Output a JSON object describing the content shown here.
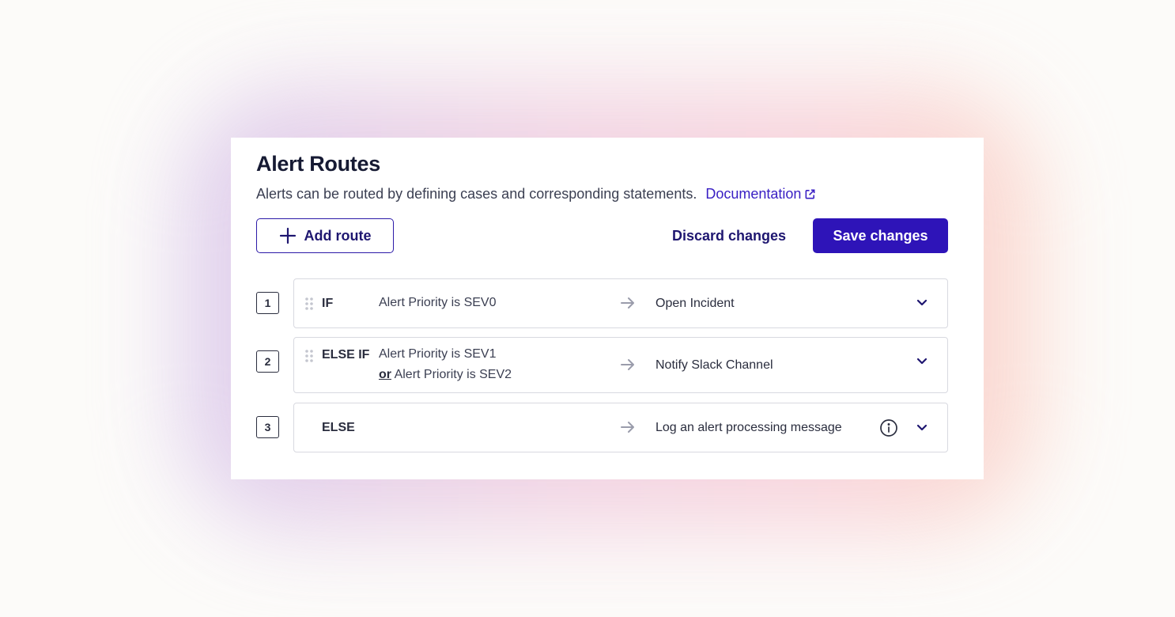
{
  "header": {
    "title": "Alert Routes",
    "description": "Alerts can be routed by defining cases and corresponding statements.",
    "doc_link": "Documentation"
  },
  "toolbar": {
    "add_label": "Add route",
    "discard_label": "Discard changes",
    "save_label": "Save changes"
  },
  "colors": {
    "accent": "#2e14b8",
    "link": "#3a20c4"
  },
  "routes": [
    {
      "number": "1",
      "keyword": "IF",
      "conditions": [
        "Alert Priority is SEV0"
      ],
      "action": "Open Incident"
    },
    {
      "number": "2",
      "keyword": "ELSE IF",
      "conditions": [
        "Alert Priority is SEV1",
        "Alert Priority is SEV2"
      ],
      "joiner": "or",
      "action": "Notify Slack Channel"
    },
    {
      "number": "3",
      "keyword": "ELSE",
      "conditions": [],
      "action": "Log an alert processing message"
    }
  ]
}
